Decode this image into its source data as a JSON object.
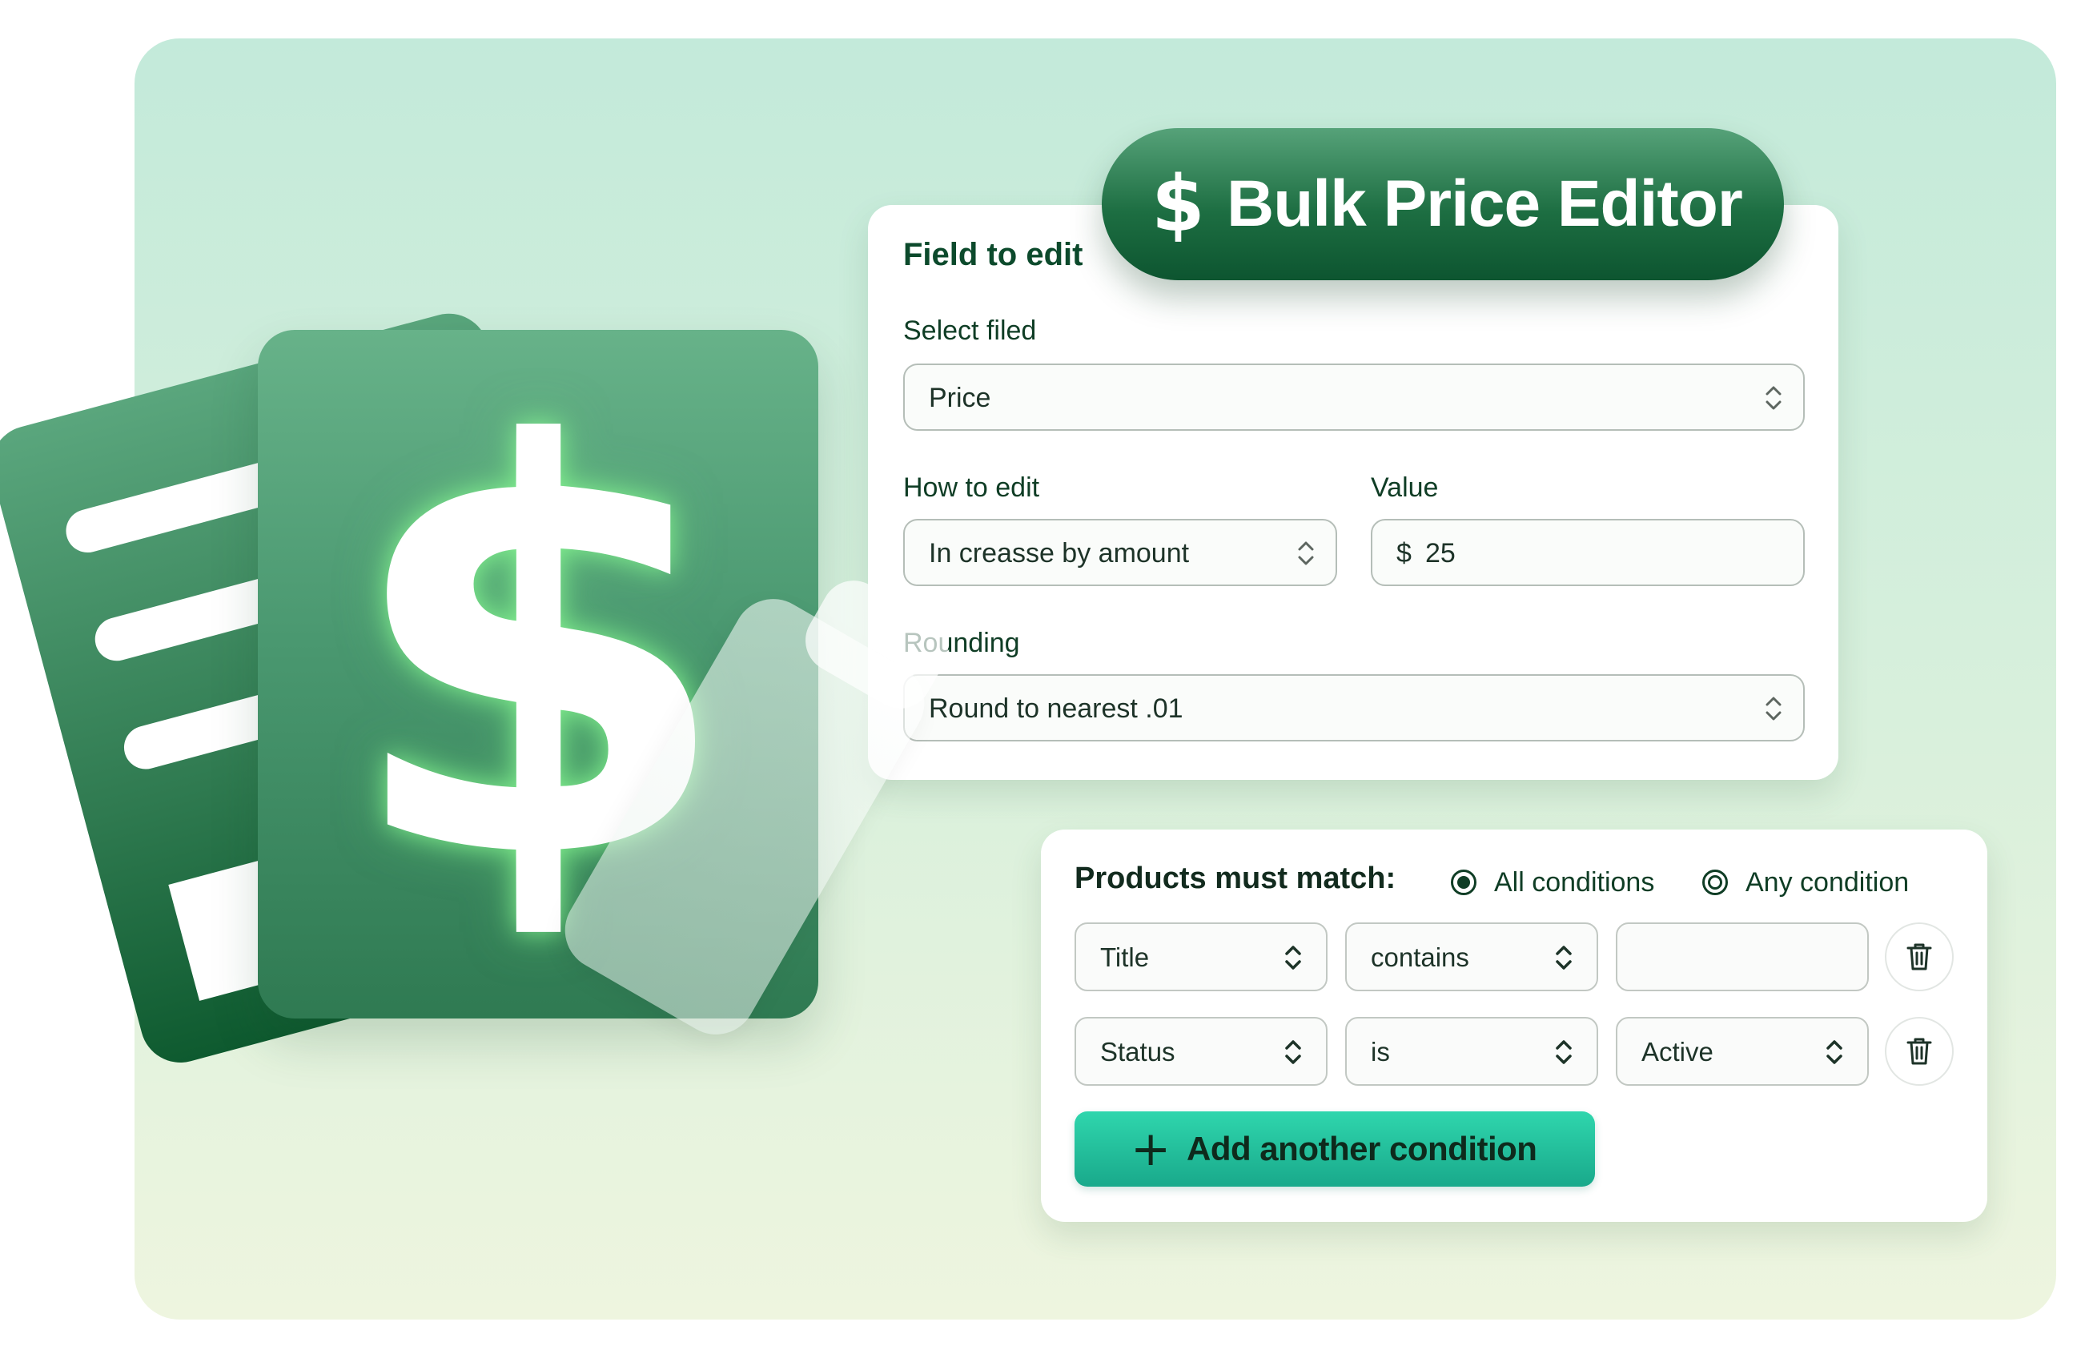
{
  "banner": {
    "icon": "dollar-icon",
    "icon_glyph": "$",
    "title": "Bulk Price Editor"
  },
  "illustration": {
    "dollar_glyph": "$"
  },
  "field_card": {
    "title": "Field to edit",
    "select_field": {
      "label": "Select filed",
      "value": "Price"
    },
    "how_to_edit": {
      "label": "How to edit",
      "value": "In creasse by amount"
    },
    "value_field": {
      "label": "Value",
      "prefix": "$",
      "value": "25"
    },
    "rounding": {
      "label": "Rounding",
      "value": "Round to nearest .01"
    }
  },
  "conditions": {
    "title": "Products must match:",
    "options": [
      {
        "label": "All conditions",
        "selected": true
      },
      {
        "label": "Any condition",
        "selected": false
      }
    ],
    "rows": [
      {
        "field": "Title",
        "operator": "contains",
        "value": ""
      },
      {
        "field": "Status",
        "operator": "is",
        "value": "Active"
      }
    ],
    "add_button": {
      "icon": "plus-icon",
      "label": "Add another condition"
    }
  },
  "colors": {
    "brand_green": "#1d6e42",
    "accent_teal": "#19a98b",
    "text_dark": "#0c4a2c"
  }
}
